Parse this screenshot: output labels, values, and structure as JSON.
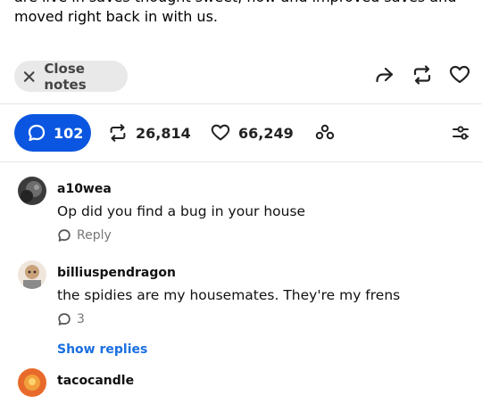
{
  "post": {
    "cut_line_1": "are live in saves thought sweet, how and improved saves and",
    "cut_line_2": "moved right back in with us."
  },
  "notes_bar": {
    "close_label": "Close notes"
  },
  "stats": {
    "replies": "102",
    "reblogs": "26,814",
    "likes": "66,249"
  },
  "comments": [
    {
      "user": "a10wea",
      "text": "Op did you find a bug in your house",
      "meta": "Reply"
    },
    {
      "user": "billiuspendragon",
      "text": "the spidies are my housemates. They're my frens",
      "meta": "3",
      "show_replies": "Show replies"
    },
    {
      "user": "tacocandle"
    }
  ],
  "colors": {
    "accent": "#0a56e0",
    "link": "#1a6fe0",
    "pill_bg": "#e9e9e9"
  }
}
